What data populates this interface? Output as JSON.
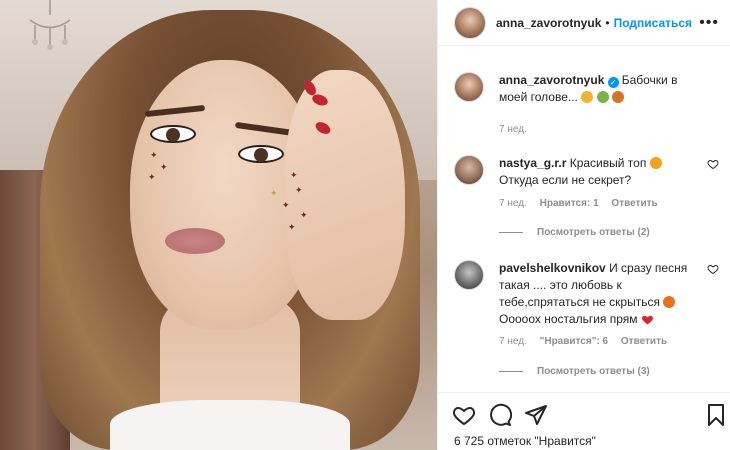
{
  "header": {
    "username": "anna_zavorotnyuk",
    "separator": "•",
    "follow_label": "Подписаться",
    "more_icon": "more-horizontal-icon"
  },
  "caption": {
    "username": "anna_zavorotnyuk",
    "text": "Бабочки в моей голове...",
    "emojis": [
      "person-emoji",
      "butterfly-emoji",
      "butterfly-emoji"
    ],
    "time": "7 нед."
  },
  "comments": [
    {
      "username": "nastya_g.r.r",
      "text_line1": "Красивый топ",
      "text_line2": "Откуда если не секрет?",
      "time": "7 нед.",
      "likes": "Нравится: 1",
      "reply": "Ответить",
      "view_replies": "Посмотреть ответы (2)"
    },
    {
      "username": "pavelshelkovnikov",
      "text_line1": "И сразу песня",
      "text_line2": "такая .... это любовь к",
      "text_line3": "тебе,спрятаться не скрыться",
      "text_line4": "Ооооох ностальгия прям",
      "time": "7 нед.",
      "likes": "\"Нравится\": 6",
      "reply": "Ответить",
      "view_replies": "Посмотреть ответы (3)"
    }
  ],
  "likes_text": "6 725 отметок \"Нравится\"",
  "colors": {
    "accent": "#0095f6",
    "heart_red": "#ed4956",
    "meta_gray": "#8e8e8e"
  }
}
